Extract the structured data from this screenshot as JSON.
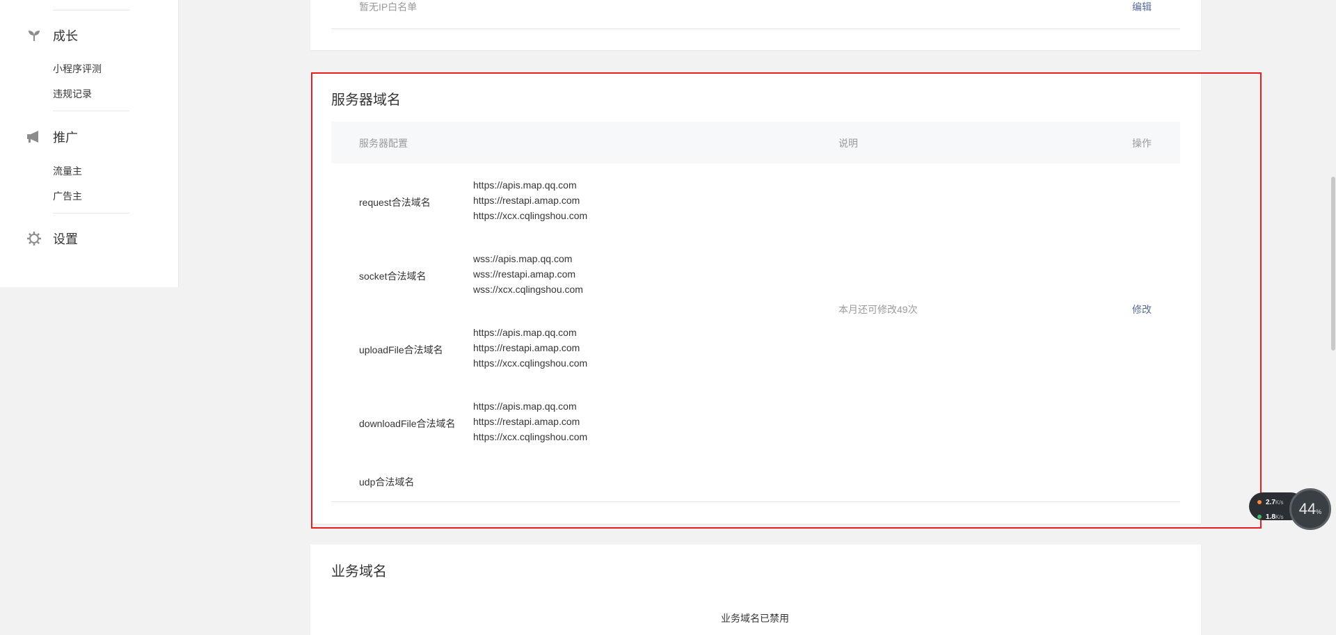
{
  "sidebar": {
    "groups": [
      {
        "label": "成长",
        "icon": "sprout-icon",
        "items": [
          "小程序评测",
          "违规记录"
        ]
      },
      {
        "label": "推广",
        "icon": "megaphone-icon",
        "items": [
          "流量主",
          "广告主"
        ]
      },
      {
        "label": "设置",
        "icon": "gear-icon",
        "items": []
      }
    ]
  },
  "ip_whitelist": {
    "empty_text": "暂无IP白名单",
    "edit_label": "编辑"
  },
  "server_domain": {
    "title": "服务器域名",
    "columns": [
      "服务器配置",
      "说明",
      "操作"
    ],
    "rows": [
      {
        "name": "request合法域名",
        "urls": [
          "https://apis.map.qq.com",
          "https://restapi.amap.com",
          "https://xcx.cqlingshou.com"
        ]
      },
      {
        "name": "socket合法域名",
        "urls": [
          "wss://apis.map.qq.com",
          "wss://restapi.amap.com",
          "wss://xcx.cqlingshou.com"
        ]
      },
      {
        "name": "uploadFile合法域名",
        "urls": [
          "https://apis.map.qq.com",
          "https://restapi.amap.com",
          "https://xcx.cqlingshou.com"
        ]
      },
      {
        "name": "downloadFile合法域名",
        "urls": [
          "https://apis.map.qq.com",
          "https://restapi.amap.com",
          "https://xcx.cqlingshou.com"
        ]
      },
      {
        "name": "udp合法域名",
        "urls": []
      }
    ],
    "description": "本月还可修改49次",
    "action_label": "修改"
  },
  "business_domain": {
    "title": "业务域名",
    "status_text": "业务域名已禁用"
  },
  "net_widget": {
    "upload_speed": "2.7",
    "download_speed": "1.8",
    "unit": "K/s",
    "percent": "44",
    "percent_unit": "%"
  },
  "colors": {
    "link": "#576b95",
    "highlight": "#e81c1c",
    "muted_text": "#9a9a9a"
  }
}
